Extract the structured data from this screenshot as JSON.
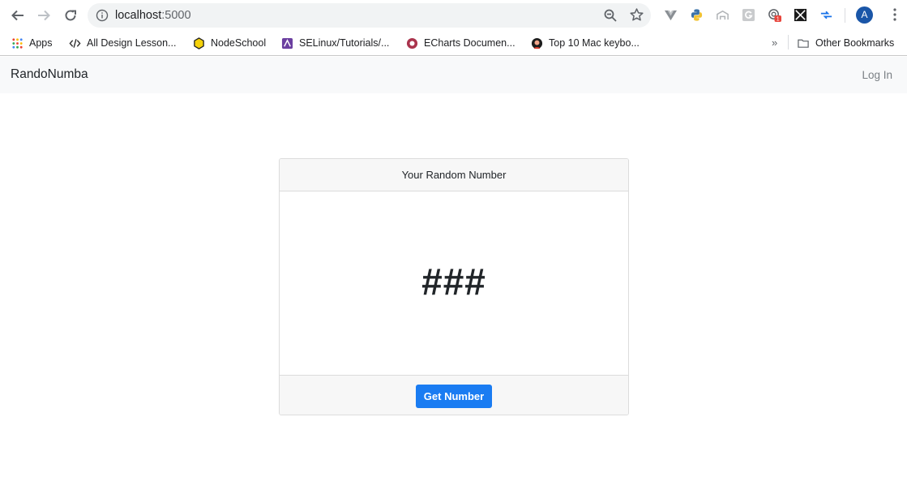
{
  "browser": {
    "url_host": "localhost",
    "url_port": ":5000",
    "profile_initial": "A",
    "extension_badge": "1",
    "bookmarks": [
      {
        "label": "Apps",
        "icon": "apps-grid-icon"
      },
      {
        "label": "All Design Lesson...",
        "icon": "design-lessons-icon"
      },
      {
        "label": "NodeSchool",
        "icon": "nodeschool-icon"
      },
      {
        "label": "SELinux/Tutorials/...",
        "icon": "selinux-icon"
      },
      {
        "label": "ECharts Documen...",
        "icon": "echarts-icon"
      },
      {
        "label": "Top 10 Mac keybo...",
        "icon": "mac-keyboard-icon"
      }
    ],
    "bookmarks_overflow": "»",
    "other_bookmarks": "Other Bookmarks"
  },
  "app": {
    "brand": "RandoNumba",
    "login_label": "Log In",
    "card": {
      "header": "Your Random Number",
      "number": "###",
      "button_label": "Get Number"
    }
  },
  "colors": {
    "primary_button": "#1a7cf2",
    "navbar_bg": "#f8f9fa",
    "card_header_bg": "#f7f7f7"
  }
}
